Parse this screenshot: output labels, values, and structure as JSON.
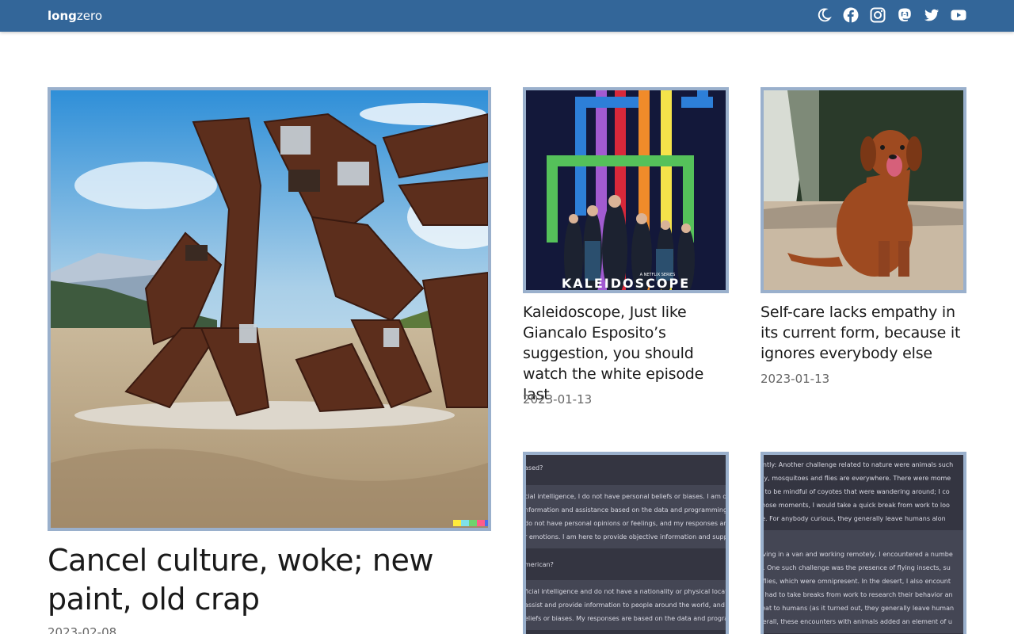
{
  "brand": {
    "bold": "long",
    "light": "zero"
  },
  "nav_icons": [
    "moon-icon",
    "facebook-icon",
    "instagram-icon",
    "mastodon-icon",
    "twitter-icon",
    "youtube-icon"
  ],
  "colors": {
    "header": "#336699",
    "thumb_border": "#9ab0cc",
    "date": "#666666"
  },
  "featured": {
    "title": "Cancel culture, woke; new paint, old crap",
    "date": "2023-02-08"
  },
  "posts": [
    {
      "title": "Kaleidoscope, Just like Giancalo Esposito’s suggestion, you should watch the white episode last",
      "date": "2023-01-13",
      "poster_text": "KALEIDOSCOPE",
      "poster_small": "A NETFLIX SERIES"
    },
    {
      "title": "Self-care lacks empathy in its current form, because it ignores everybody else",
      "date": "2023-01-13"
    }
  ],
  "chat1": {
    "lines": [
      "ased?",
      "cial intelligence, I do not have personal beliefs or biases. I am designe",
      "nformation and assistance based on the data and programming that I ha",
      " do not have personal opinions or feelings, and my responses are not",
      "r emotions. I am here to provide objective information and support to",
      "merican?",
      "ficial intelligence and do not have a nationality or physical location. I a",
      " assist and provide information to people around the world, and I do",
      "eliefs or biases. My responses are based on the data and programmin"
    ]
  },
  "chat2": {
    "lines": [
      "ently: Another challenge related to nature were animals such",
      "sly, mosquitoes and flies are everywhere. There were mome",
      "d to be mindful of coyotes that were wandering around; I co",
      " those moments, I would take a quick break from work to loo",
      "re. For anybody curious, they generally leave humans alon",
      " living in a van and working remotely, I encountered a numbe",
      "e. One such challenge was the presence of flying insects, su",
      "l flies, which were omnipresent. In the desert, I also encount",
      "d had to take breaks from work to research their behavior an",
      "reat to humans (as it turned out, they generally leave human",
      "verall, these encounters with animals added an element of u"
    ]
  }
}
